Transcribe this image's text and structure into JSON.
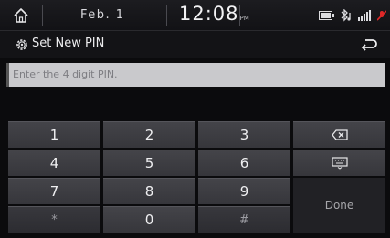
{
  "status": {
    "date": "Feb.  1",
    "time": "12:08",
    "ampm": "PM"
  },
  "title": {
    "text": "Set New PIN"
  },
  "pin_field": {
    "placeholder": "Enter the 4 digit PIN."
  },
  "keypad": {
    "keys": [
      "1",
      "2",
      "3",
      "4",
      "5",
      "6",
      "7",
      "8",
      "9",
      "*",
      "0",
      "#"
    ],
    "done_label": "Done"
  },
  "icons": {
    "home": "home-icon",
    "gear": "gear-icon",
    "back": "back-arrow-icon",
    "backspace": "backspace-icon",
    "keyboard": "keyboard-icon",
    "battery": "battery-icon",
    "bluetooth_audio": "bluetooth-audio-icon",
    "signal": "signal-icon",
    "mic_mute": "mic-mute-icon"
  },
  "colors": {
    "background": "#0b0b0d",
    "input_bg": "#c9c9cc",
    "key_bg": "#3e3e43",
    "mute_red": "#e02828"
  }
}
